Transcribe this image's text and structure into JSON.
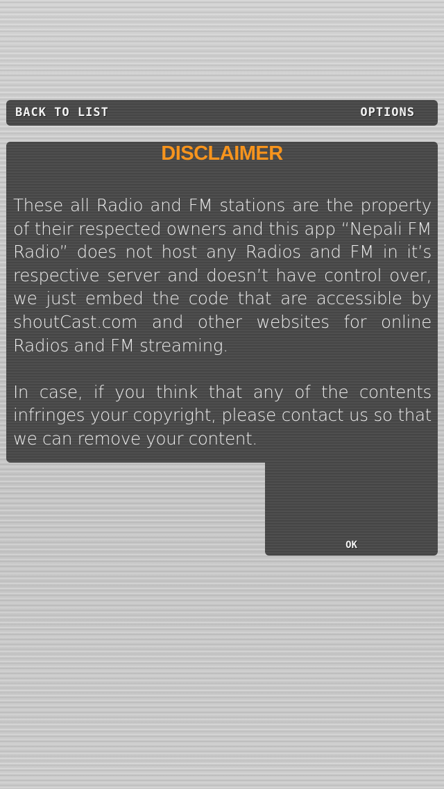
{
  "top_bar": {
    "back_label": "Back to list",
    "options_label": "Options"
  },
  "dialog": {
    "title": "DISCLAIMER",
    "paragraph_1": "These all Radio and FM stations are the property of their respected owners and this app “Nepali FM Radio” does not host any Radios and FM in it’s respective server and doesn’t have control over, we just embed the code that are accessible by shoutCast.com and other websites for online Radios and FM streaming.",
    "paragraph_2": "In case, if you think that any of the contents infringes your copyright, please contact us so that we can remove your content.",
    "ok_label": "OK"
  },
  "colors": {
    "title_accent": "#f7941d",
    "panel": "#4a4a4a",
    "background": "#c9c9c9"
  }
}
